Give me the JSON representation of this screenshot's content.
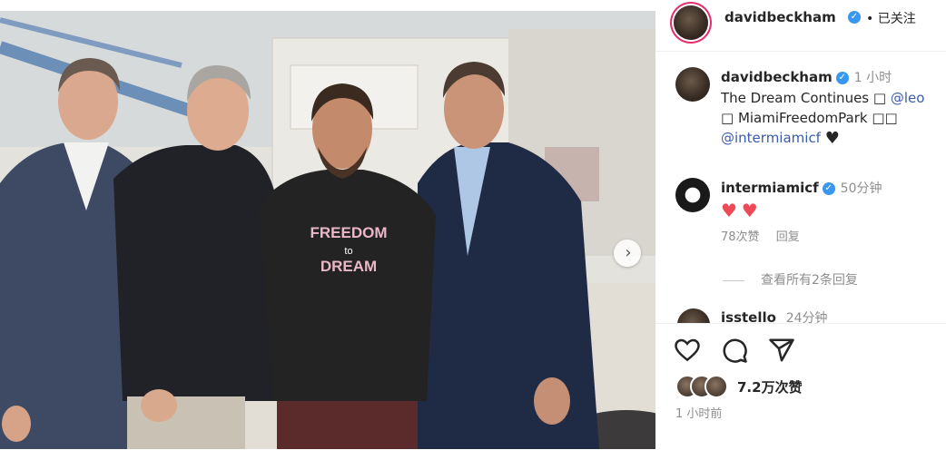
{
  "photo": {
    "shirt_text": [
      "FREEDOM",
      "to",
      "DREAM"
    ],
    "next_icon": "chevron-right-icon"
  },
  "header": {
    "username": "davidbeckham",
    "follow_status": "• 已关注"
  },
  "caption": {
    "username": "davidbeckham",
    "time": "1 小时",
    "line1": "The Dream Continues □",
    "mention1": "@leo",
    "line2": "□ MiamiFreedomPark □□",
    "mention2": "@intermiamicf"
  },
  "comments": [
    {
      "username": "intermiamicf",
      "time": "50分钟",
      "likes": "78次赞",
      "reply_label": "回复",
      "view_replies": "查看所有2条回复"
    }
  ],
  "partial_comment": {
    "username": "isstello",
    "time": "24分钟"
  },
  "actions": {
    "icons": [
      "heart-icon",
      "comment-icon",
      "share-icon"
    ],
    "likes_count": "7.2万次赞",
    "post_time": "1 小时前"
  },
  "colors": {
    "verified_blue": "#3897f0",
    "link_blue": "#3a5cae",
    "heart_red": "#ed4956",
    "story_ring": "#e1306c"
  }
}
